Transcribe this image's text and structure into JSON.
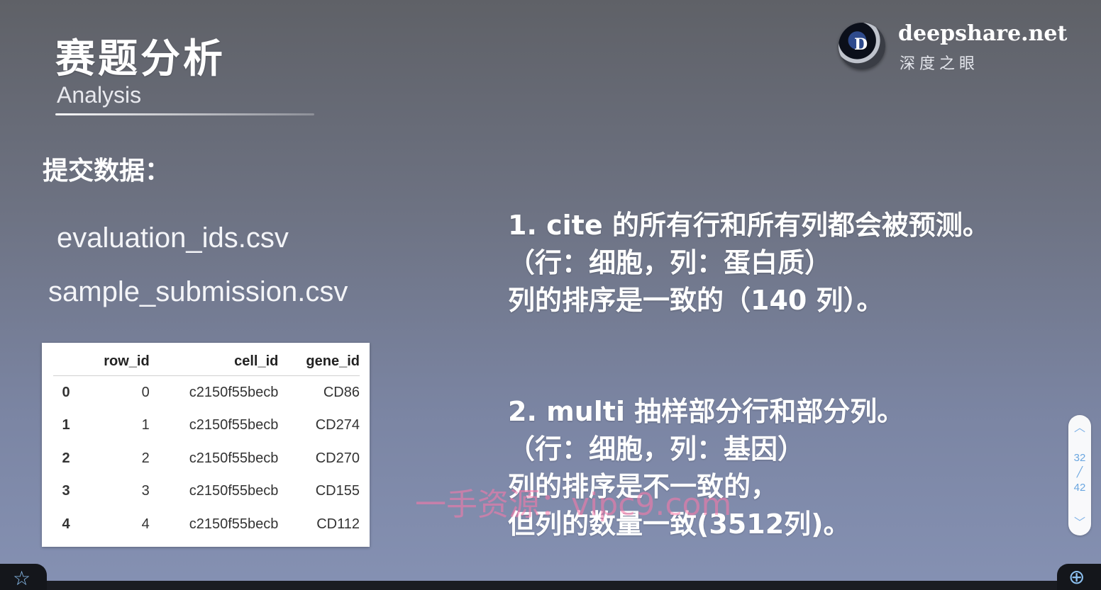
{
  "slide": {
    "title_cn": "赛题分析",
    "title_en": "Analysis",
    "section_heading": "提交数据：",
    "files": [
      "evaluation_ids.csv",
      "sample_submission.csv"
    ]
  },
  "logo": {
    "icon_letter": "D",
    "name": "deepshare.net",
    "sub": "深度之眼"
  },
  "table": {
    "headers": [
      "",
      "row_id",
      "cell_id",
      "gene_id"
    ],
    "rows": [
      [
        "0",
        "0",
        "c2150f55becb",
        "CD86"
      ],
      [
        "1",
        "1",
        "c2150f55becb",
        "CD274"
      ],
      [
        "2",
        "2",
        "c2150f55becb",
        "CD270"
      ],
      [
        "3",
        "3",
        "c2150f55becb",
        "CD155"
      ],
      [
        "4",
        "4",
        "c2150f55becb",
        "CD112"
      ]
    ]
  },
  "notes": {
    "block1": [
      "1. cite 的所有行和所有列都会被预测。",
      "（行：细胞，列：蛋白质）",
      "列的排序是一致的（140 列）。"
    ],
    "block2": [
      "2. multi 抽样部分行和部分列。",
      "（行：细胞，列：基因）",
      "列的排序是不一致的，",
      "但列的数量一致(3512列)。"
    ]
  },
  "watermark": "一手资源：vipc9.com",
  "pager": {
    "up": "︿",
    "current": "32",
    "separator": "╱",
    "total": "42",
    "down": "﹀"
  },
  "controls": {
    "star_icon": "☆",
    "zoom_icon": "⊕"
  }
}
